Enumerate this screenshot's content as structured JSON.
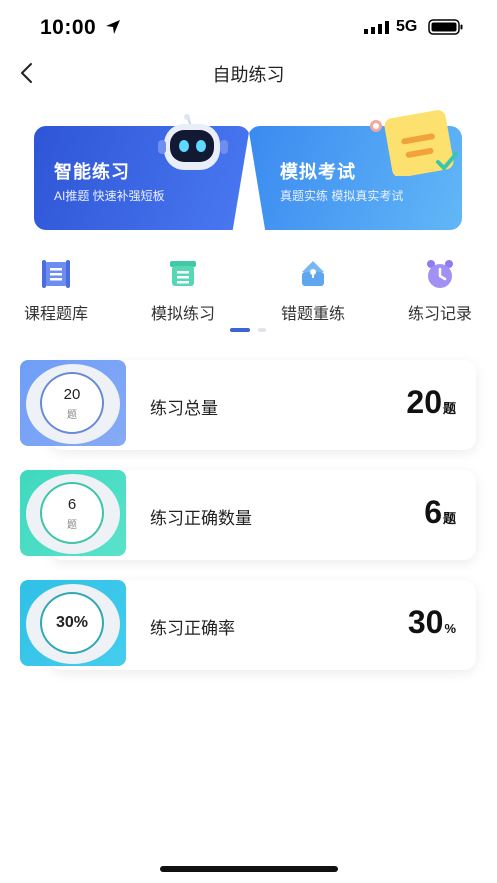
{
  "status_bar": {
    "time": "10:00",
    "network": "5G"
  },
  "nav": {
    "title": "自助练习"
  },
  "banners": [
    {
      "title": "智能练习",
      "subtitle": "AI推题 快速补强短板"
    },
    {
      "title": "模拟考试",
      "subtitle": "真题实练 模拟真实考试"
    }
  ],
  "quick_menu": [
    {
      "label": "课程题库",
      "icon": "course-bank-icon"
    },
    {
      "label": "模拟练习",
      "icon": "mock-practice-icon"
    },
    {
      "label": "错题重练",
      "icon": "wrong-question-icon"
    },
    {
      "label": "练习记录",
      "icon": "clock-record-icon"
    }
  ],
  "stats": [
    {
      "tile_number": "20",
      "tile_unit": "题",
      "label": "练习总量",
      "value": "20",
      "unit": "题"
    },
    {
      "tile_number": "6",
      "tile_unit": "题",
      "label": "练习正确数量",
      "value": "6",
      "unit": "题"
    },
    {
      "tile_text": "30%",
      "label": "练习正确率",
      "value": "30",
      "unit": "%"
    }
  ],
  "colors": {
    "accent": "#3b63d8",
    "banner_smart": "#2e55d6",
    "banner_mock": "#3a8af0"
  }
}
